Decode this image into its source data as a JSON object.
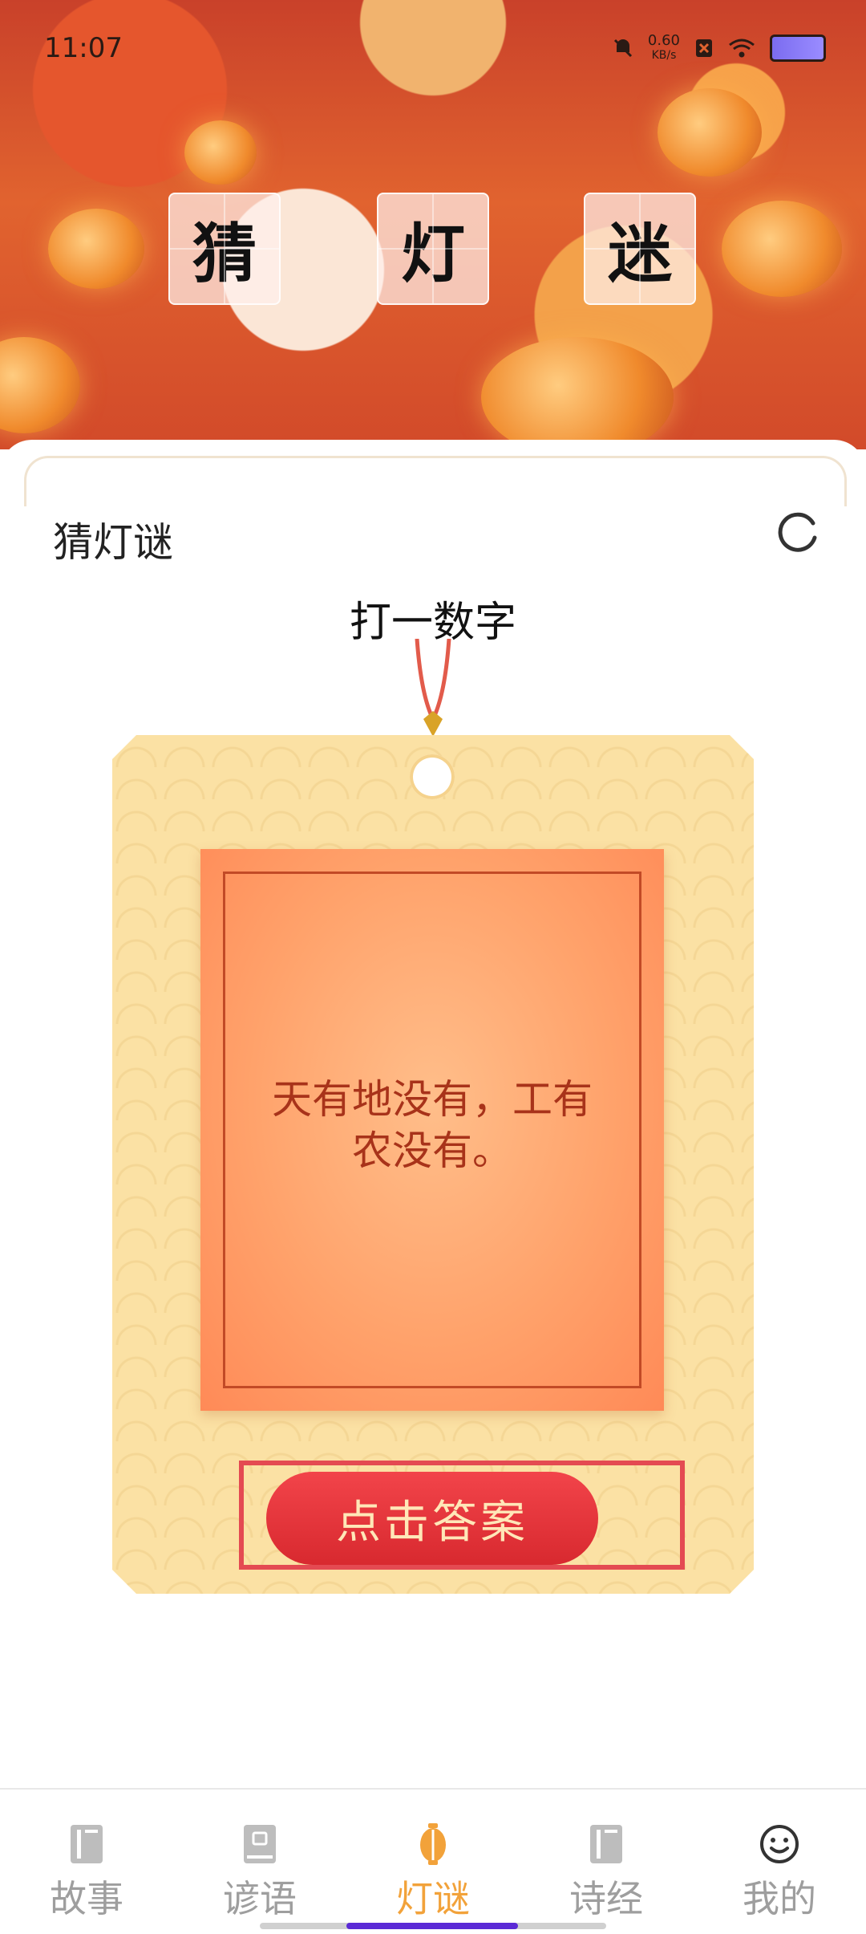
{
  "status_bar": {
    "time": "11:07",
    "net_speed_value": "0.60",
    "net_speed_unit": "KB/s"
  },
  "hero": {
    "tiles": [
      "猜",
      "灯",
      "迷"
    ]
  },
  "page": {
    "title": "猜灯谜",
    "refresh_icon": "refresh-icon"
  },
  "riddle": {
    "hint": "打一数字",
    "text": "天有地没有，工有农没有。"
  },
  "answer_button": {
    "label": "点击答案"
  },
  "bottom_nav": {
    "items": [
      {
        "label": "故事",
        "icon": "book-icon",
        "active": false
      },
      {
        "label": "谚语",
        "icon": "proverb-book-icon",
        "active": false
      },
      {
        "label": "灯谜",
        "icon": "lantern-icon",
        "active": true
      },
      {
        "label": "诗经",
        "icon": "book-icon",
        "active": false
      },
      {
        "label": "我的",
        "icon": "smiley-icon",
        "active": false
      }
    ]
  },
  "colors": {
    "accent": "#f2a23a",
    "button": "#e2353b",
    "riddle_text": "#a8331a"
  }
}
